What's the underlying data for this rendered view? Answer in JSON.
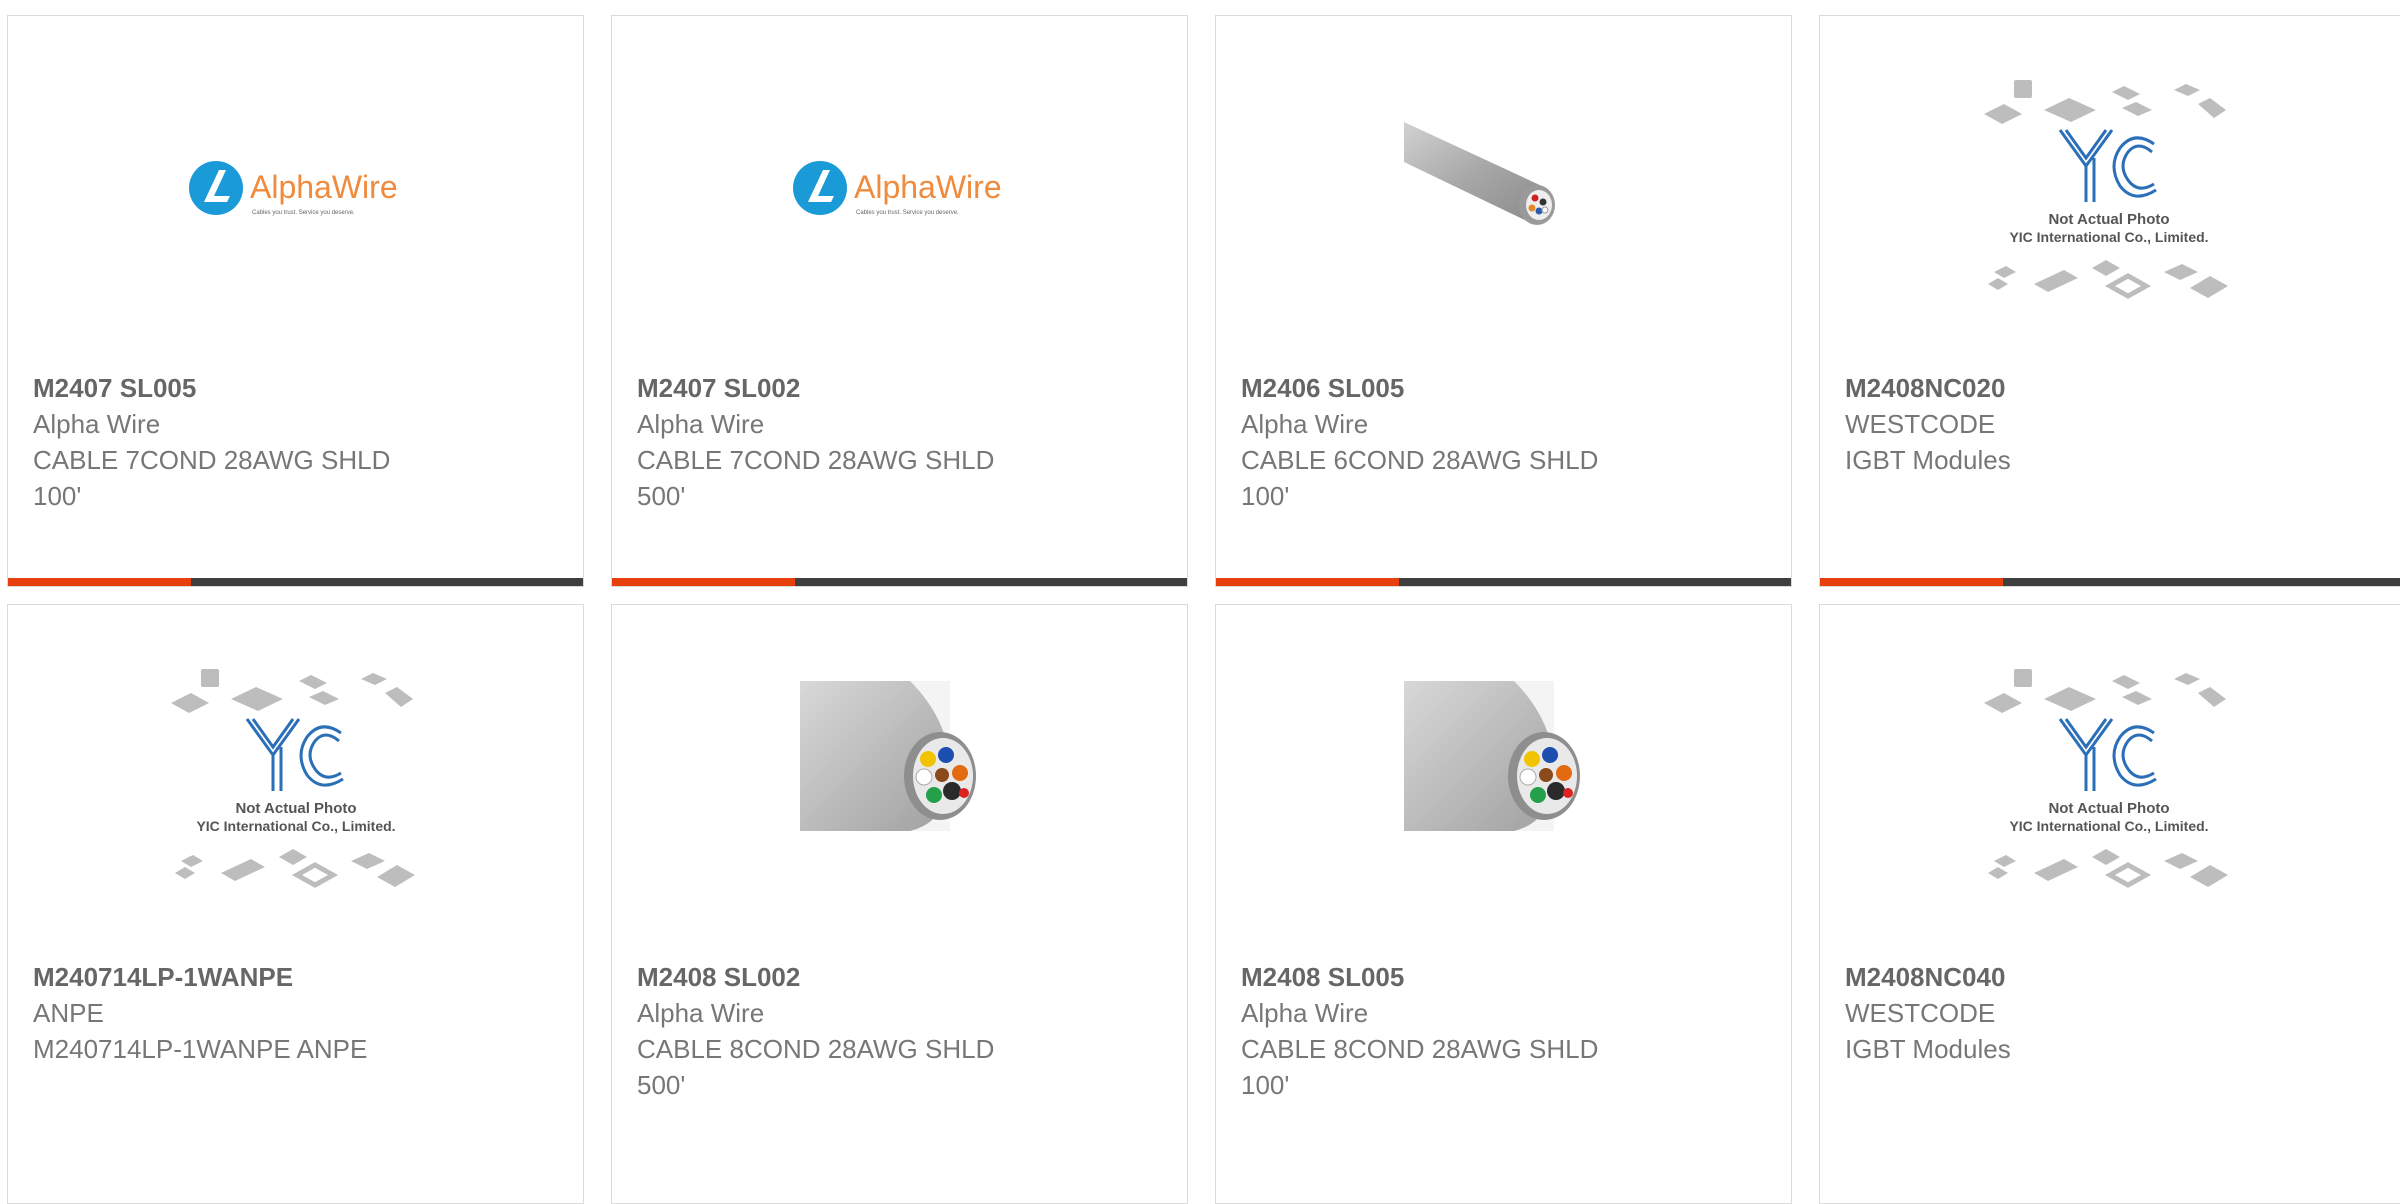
{
  "products": [
    {
      "part": "M2407 SL005",
      "brand": "Alpha Wire",
      "desc1": "CABLE 7COND 28AWG SHLD",
      "desc2": "100'",
      "image": "alphawire-logo"
    },
    {
      "part": "M2407 SL002",
      "brand": "Alpha Wire",
      "desc1": "CABLE 7COND 28AWG SHLD",
      "desc2": "500'",
      "image": "alphawire-logo"
    },
    {
      "part": "M2406 SL005",
      "brand": "Alpha Wire",
      "desc1": "CABLE 6COND 28AWG SHLD",
      "desc2": "100'",
      "image": "cable-side-photo"
    },
    {
      "part": "M2408NC020",
      "brand": "WESTCODE",
      "desc1": "IGBT Modules",
      "desc2": "",
      "image": "yic-placeholder"
    },
    {
      "part": "M240714LP-1WANPE",
      "brand": "ANPE",
      "desc1": "M240714LP-1WANPE ANPE",
      "desc2": "",
      "image": "yic-placeholder"
    },
    {
      "part": "M2408 SL002",
      "brand": "Alpha Wire",
      "desc1": "CABLE 8COND 28AWG SHLD",
      "desc2": "500'",
      "image": "cable-end-photo"
    },
    {
      "part": "M2408 SL005",
      "brand": "Alpha Wire",
      "desc1": "CABLE 8COND 28AWG SHLD",
      "desc2": "100'",
      "image": "cable-end-photo"
    },
    {
      "part": "M2408NC040",
      "brand": "WESTCODE",
      "desc1": "IGBT Modules",
      "desc2": "",
      "image": "yic-placeholder"
    }
  ],
  "logos": {
    "alphawire": {
      "name": "AlphaWire",
      "tagline": "Cables you trust. Service you deserve."
    },
    "yic": {
      "mark": "YIC",
      "line1": "Not Actual Photo",
      "line2": "YIC International Co., Limited."
    }
  },
  "colors": {
    "accent": "#e8400c",
    "bar": "#3f3f3f",
    "alphawire_blue": "#1a9bd7",
    "alphawire_orange": "#f08a3c",
    "yic_blue": "#2a6fb8"
  }
}
